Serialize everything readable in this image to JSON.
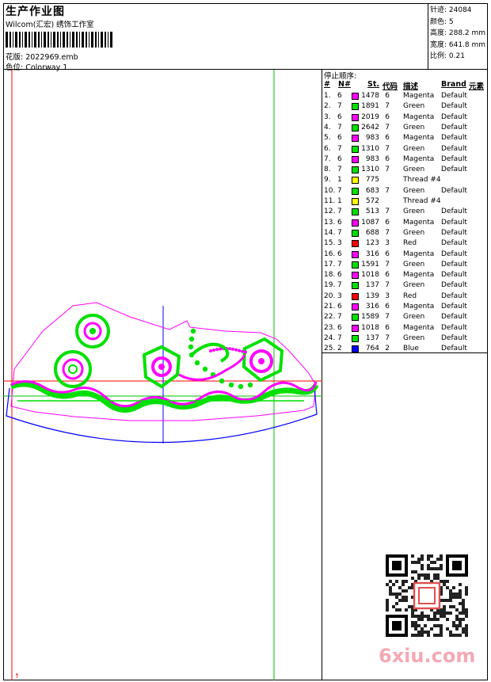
{
  "header": {
    "title": "生产作业图",
    "subtitle": "Wilcom(汇宏) 绣饰工作室",
    "design_label": "花版: 2022969.emb",
    "colorway_label": "色位: Colorway 1"
  },
  "stats": [
    "针迹: 24084",
    "颜色: 5",
    "高度: 288.2 mm",
    "宽度: 641.8 mm",
    "比例: 0.21"
  ],
  "stop_sequence": {
    "title": "停止顺序:",
    "headers": {
      "num": "#",
      "n": "N#",
      "st": "St.",
      "code": "代码",
      "desc": "描述",
      "brand": "Brand",
      "elem": "元素"
    },
    "rows": [
      {
        "num": "1.",
        "n": "6",
        "color": "#ff00ff",
        "st": "1478",
        "code": "6",
        "desc": "Magenta",
        "brand": "Default"
      },
      {
        "num": "2.",
        "n": "7",
        "color": "#00e000",
        "st": "1891",
        "code": "7",
        "desc": "Green",
        "brand": "Default"
      },
      {
        "num": "3.",
        "n": "6",
        "color": "#ff00ff",
        "st": "2019",
        "code": "6",
        "desc": "Magenta",
        "brand": "Default"
      },
      {
        "num": "4.",
        "n": "7",
        "color": "#00e000",
        "st": "2642",
        "code": "7",
        "desc": "Green",
        "brand": "Default"
      },
      {
        "num": "5.",
        "n": "6",
        "color": "#ff00ff",
        "st": "983",
        "code": "6",
        "desc": "Magenta",
        "brand": "Default"
      },
      {
        "num": "6.",
        "n": "7",
        "color": "#00e000",
        "st": "1310",
        "code": "7",
        "desc": "Green",
        "brand": "Default"
      },
      {
        "num": "7.",
        "n": "6",
        "color": "#ff00ff",
        "st": "983",
        "code": "6",
        "desc": "Magenta",
        "brand": "Default"
      },
      {
        "num": "8.",
        "n": "7",
        "color": "#00e000",
        "st": "1310",
        "code": "7",
        "desc": "Green",
        "brand": "Default"
      },
      {
        "num": "9.",
        "n": "1",
        "color": "#ffff00",
        "st": "775",
        "code": "",
        "desc": "Thread #4",
        "brand": ""
      },
      {
        "num": "10.",
        "n": "7",
        "color": "#00e000",
        "st": "683",
        "code": "7",
        "desc": "Green",
        "brand": "Default"
      },
      {
        "num": "11.",
        "n": "1",
        "color": "#ffff00",
        "st": "572",
        "code": "",
        "desc": "Thread #4",
        "brand": ""
      },
      {
        "num": "12.",
        "n": "7",
        "color": "#00e000",
        "st": "513",
        "code": "7",
        "desc": "Green",
        "brand": "Default"
      },
      {
        "num": "13.",
        "n": "6",
        "color": "#ff00ff",
        "st": "1087",
        "code": "6",
        "desc": "Magenta",
        "brand": "Default"
      },
      {
        "num": "14.",
        "n": "7",
        "color": "#00e000",
        "st": "688",
        "code": "7",
        "desc": "Green",
        "brand": "Default"
      },
      {
        "num": "15.",
        "n": "3",
        "color": "#ff0000",
        "st": "123",
        "code": "3",
        "desc": "Red",
        "brand": "Default"
      },
      {
        "num": "16.",
        "n": "6",
        "color": "#ff00ff",
        "st": "316",
        "code": "6",
        "desc": "Magenta",
        "brand": "Default"
      },
      {
        "num": "17.",
        "n": "7",
        "color": "#00e000",
        "st": "1591",
        "code": "7",
        "desc": "Green",
        "brand": "Default"
      },
      {
        "num": "18.",
        "n": "6",
        "color": "#ff00ff",
        "st": "1018",
        "code": "6",
        "desc": "Magenta",
        "brand": "Default"
      },
      {
        "num": "19.",
        "n": "7",
        "color": "#00e000",
        "st": "137",
        "code": "7",
        "desc": "Green",
        "brand": "Default"
      },
      {
        "num": "20.",
        "n": "3",
        "color": "#ff0000",
        "st": "139",
        "code": "3",
        "desc": "Red",
        "brand": "Default"
      },
      {
        "num": "21.",
        "n": "6",
        "color": "#ff00ff",
        "st": "316",
        "code": "6",
        "desc": "Magenta",
        "brand": "Default"
      },
      {
        "num": "22.",
        "n": "7",
        "color": "#00e000",
        "st": "1589",
        "code": "7",
        "desc": "Green",
        "brand": "Default"
      },
      {
        "num": "23.",
        "n": "6",
        "color": "#ff00ff",
        "st": "1018",
        "code": "6",
        "desc": "Magenta",
        "brand": "Default"
      },
      {
        "num": "24.",
        "n": "7",
        "color": "#00e000",
        "st": "137",
        "code": "7",
        "desc": "Green",
        "brand": "Default"
      },
      {
        "num": "25.",
        "n": "2",
        "color": "#0000ff",
        "st": "764",
        "code": "2",
        "desc": "Blue",
        "brand": "Default"
      }
    ]
  },
  "watermark": {
    "logo_text": "6xiu.com",
    "qr_icon": "qr-code-icon"
  },
  "colors": {
    "magenta": "#ff00ff",
    "green": "#00e000",
    "red": "#ff0000",
    "blue": "#0000ff"
  }
}
